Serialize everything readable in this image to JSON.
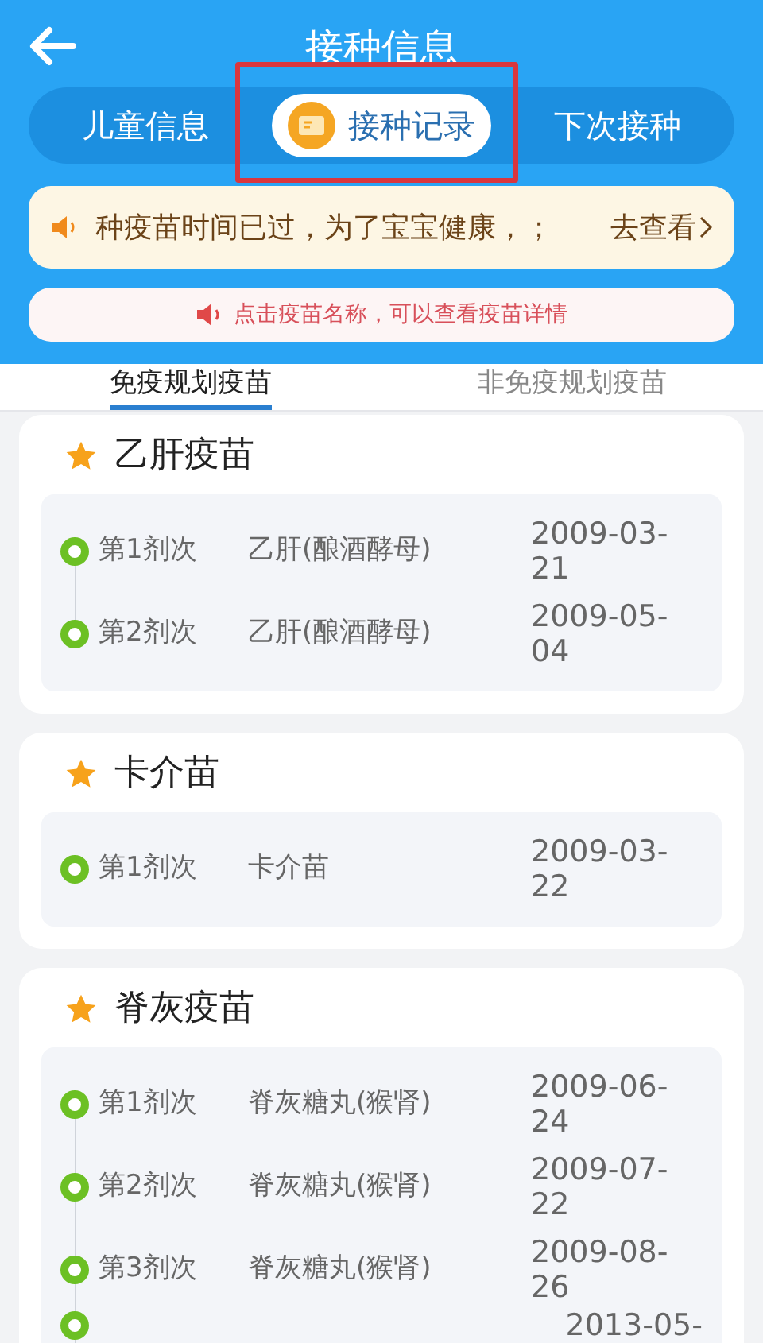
{
  "header": {
    "title": "接种信息"
  },
  "tabs": [
    {
      "label": "儿童信息",
      "selected": false
    },
    {
      "label": "接种记录",
      "selected": true,
      "highlighted": true
    },
    {
      "label": "下次接种",
      "selected": false
    }
  ],
  "notice": {
    "text": "种疫苗时间已过，为了宝宝健康，；",
    "link": "去查看"
  },
  "tip": {
    "text": "点击疫苗名称，可以查看疫苗详情"
  },
  "sub_tabs": [
    {
      "label": "免疫规划疫苗",
      "selected": true
    },
    {
      "label": "非免疫规划疫苗",
      "selected": false
    }
  ],
  "vaccines": [
    {
      "name": "乙肝疫苗",
      "doses": [
        {
          "dose": "第1剂次",
          "product": "乙肝(酿酒酵母)",
          "date": "2009-03-21"
        },
        {
          "dose": "第2剂次",
          "product": "乙肝(酿酒酵母)",
          "date": "2009-05-04"
        }
      ]
    },
    {
      "name": "卡介苗",
      "doses": [
        {
          "dose": "第1剂次",
          "product": "卡介苗",
          "date": "2009-03-22"
        }
      ]
    },
    {
      "name": "脊灰疫苗",
      "doses": [
        {
          "dose": "第1剂次",
          "product": "脊灰糖丸(猴肾)",
          "date": "2009-06-24"
        },
        {
          "dose": "第2剂次",
          "product": "脊灰糖丸(猴肾)",
          "date": "2009-07-22"
        },
        {
          "dose": "第3剂次",
          "product": "脊灰糖丸(猴肾)",
          "date": "2009-08-26"
        },
        {
          "date": "2013-05-"
        }
      ]
    }
  ]
}
